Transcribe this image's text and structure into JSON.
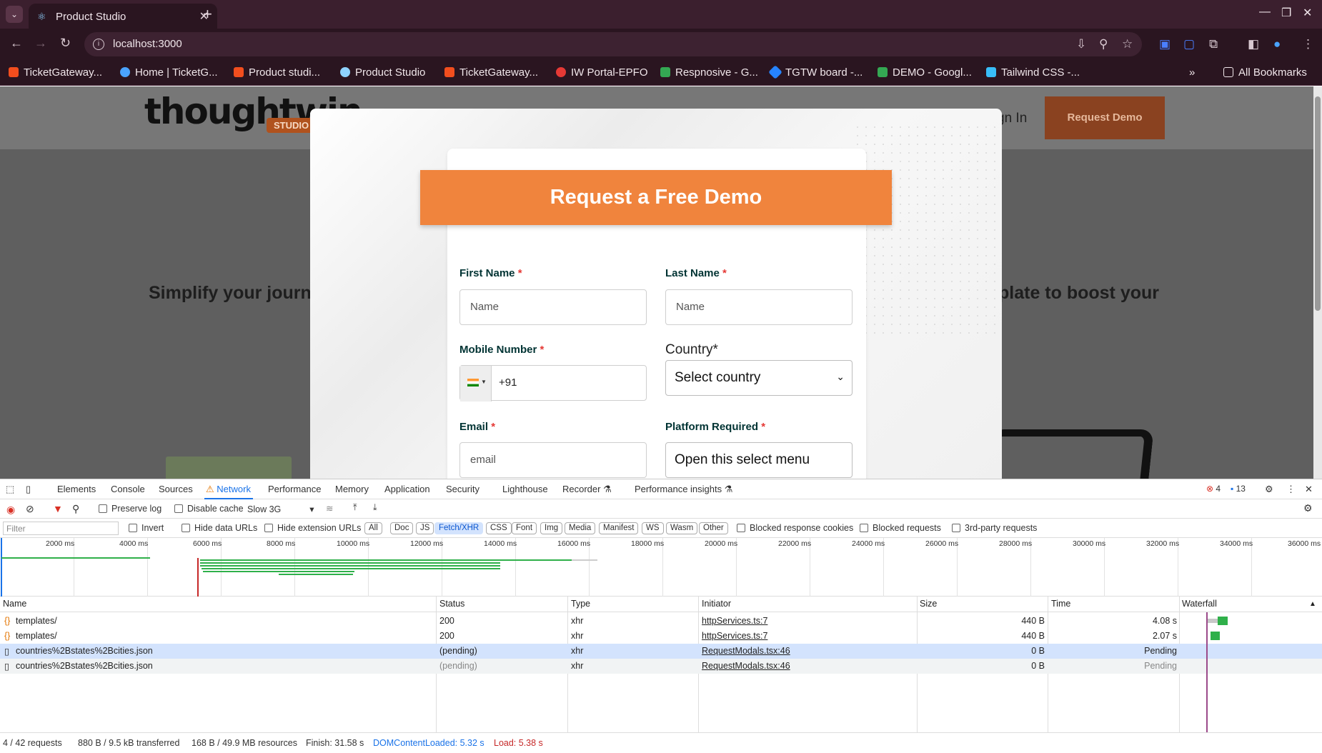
{
  "browser": {
    "tab_title": "Product Studio",
    "url": "localhost:3000",
    "bookmarks": [
      {
        "label": "TicketGateway...",
        "color": "#f24e1e"
      },
      {
        "label": "Home | TicketG...",
        "color": "#4aa3ff"
      },
      {
        "label": "Product studi...",
        "color": "#f24e1e"
      },
      {
        "label": "Product Studio",
        "color": "#8fd3ff"
      },
      {
        "label": "TicketGateway...",
        "color": "#f24e1e"
      },
      {
        "label": "IW Portal-EPFO",
        "color": "#e53935"
      },
      {
        "label": "Respnosive - G...",
        "color": "#34a853"
      },
      {
        "label": "TGTW board -...",
        "color": "#2684ff"
      },
      {
        "label": "DEMO - Googl...",
        "color": "#34a853"
      },
      {
        "label": "Tailwind CSS -...",
        "color": "#38bdf8"
      }
    ],
    "all_bookmarks": "All Bookmarks"
  },
  "site": {
    "logo_text": "thoughtwin",
    "logo_tag": "STUDIO",
    "sign_in": "gn In",
    "request_demo": "Request Demo",
    "hero_left": "Simplify your journ",
    "hero_right": "plate to boost your"
  },
  "modal": {
    "title": "Request a Free Demo",
    "first_name_label": "First Name",
    "first_name_placeholder": "Name",
    "last_name_label": "Last Name",
    "last_name_placeholder": "Name",
    "mobile_label": "Mobile Number",
    "mobile_value": "+91",
    "country_label": "Country*",
    "country_value": "Select country",
    "email_label": "Email",
    "email_placeholder": "email",
    "platform_label": "Platform Required",
    "platform_value": "Open this select menu",
    "required_mark": "*"
  },
  "devtools": {
    "tabs": [
      "Elements",
      "Console",
      "Sources",
      "Network",
      "Performance",
      "Memory",
      "Application",
      "Security",
      "Lighthouse",
      "Recorder",
      "Performance insights"
    ],
    "error_count": "4",
    "message_count": "13",
    "preserve_log": "Preserve log",
    "disable_cache": "Disable cache",
    "throttle": "Slow 3G",
    "filter_placeholder": "Filter",
    "invert": "Invert",
    "hide_data_urls": "Hide data URLs",
    "hide_extension_urls": "Hide extension URLs",
    "type_filters": [
      "All",
      "Doc",
      "JS",
      "Fetch/XHR",
      "CSS",
      "Font",
      "Img",
      "Media",
      "Manifest",
      "WS",
      "Wasm",
      "Other"
    ],
    "active_filter": "Fetch/XHR",
    "blocked_cookies": "Blocked response cookies",
    "blocked_requests": "Blocked requests",
    "third_party": "3rd-party requests",
    "timeline_ticks": [
      "2000 ms",
      "4000 ms",
      "6000 ms",
      "8000 ms",
      "10000 ms",
      "12000 ms",
      "14000 ms",
      "16000 ms",
      "18000 ms",
      "20000 ms",
      "22000 ms",
      "24000 ms",
      "26000 ms",
      "28000 ms",
      "30000 ms",
      "32000 ms",
      "34000 ms",
      "36000 ms"
    ],
    "columns": [
      "Name",
      "Status",
      "Type",
      "Initiator",
      "Size",
      "Time",
      "Waterfall"
    ],
    "rows": [
      {
        "name": "templates/",
        "status": "200",
        "type": "xhr",
        "initiator": "httpServices.ts:7",
        "size": "440 B",
        "time": "4.08 s"
      },
      {
        "name": "templates/",
        "status": "200",
        "type": "xhr",
        "initiator": "httpServices.ts:7",
        "size": "440 B",
        "time": "2.07 s"
      },
      {
        "name": "countries%2Bstates%2Bcities.json",
        "status": "(pending)",
        "type": "xhr",
        "initiator": "RequestModals.tsx:46",
        "size": "0 B",
        "time": "Pending"
      },
      {
        "name": "countries%2Bstates%2Bcities.json",
        "status": "(pending)",
        "type": "xhr",
        "initiator": "RequestModals.tsx:46",
        "size": "0 B",
        "time": "Pending"
      }
    ],
    "status": {
      "requests": "4 / 42 requests",
      "transferred": "880 B / 9.5 kB transferred",
      "resources": "168 B / 49.9 MB resources",
      "finish": "Finish: 31.58 s",
      "dom_loaded": "DOMContentLoaded: 5.32 s",
      "load": "Load: 5.38 s"
    }
  }
}
